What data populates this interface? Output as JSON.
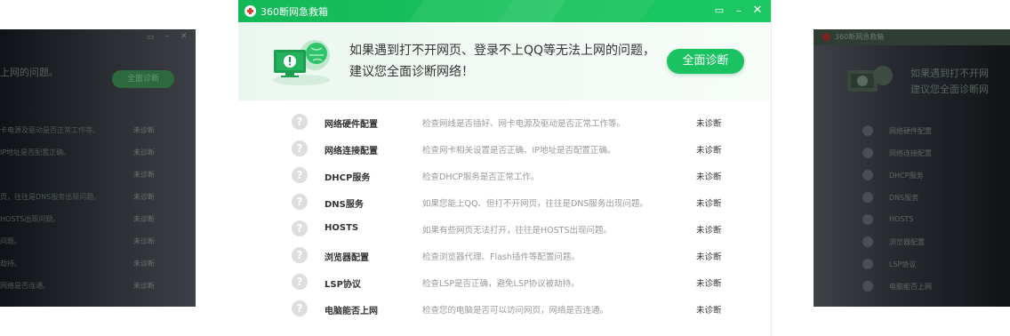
{
  "app": {
    "title": "360断网急救箱"
  },
  "hero": {
    "line1": "如果遇到打不开网页、登录不上QQ等无法上网的问题，",
    "line2": "建议您全面诊断网络！",
    "button": "全面诊断"
  },
  "rows": [
    {
      "name": "网络硬件配置",
      "desc": "检查网线是否插好、网卡电源及驱动是否正常工作等。",
      "status": "未诊断"
    },
    {
      "name": "网络连接配置",
      "desc": "检查网卡相关设置是否正确、IP地址是否配置正确。",
      "status": "未诊断"
    },
    {
      "name": "DHCP服务",
      "desc": "检查DHCP服务是否正常工作。",
      "status": "未诊断"
    },
    {
      "name": "DNS服务",
      "desc": "如果您能上QQ、但打不开网页，往往是DNS服务出现问题。",
      "status": "未诊断"
    },
    {
      "name": "HOSTS",
      "desc": "如果有些网页无法打开，往往是HOSTS出现问题。",
      "status": "未诊断"
    },
    {
      "name": "浏览器配置",
      "desc": "检查浏览器代理、Flash插件等配置问题。",
      "status": "未诊断"
    },
    {
      "name": "LSP协议",
      "desc": "检查LSP是否正确，避免LSP协议被劫持。",
      "status": "未诊断"
    },
    {
      "name": "电脑能否上网",
      "desc": "检查您的电脑是否可以访问网页，网络是否连通。",
      "status": "未诊断"
    }
  ],
  "ghost_left": {
    "hero_fragment": "上网的问题。",
    "button": "全面诊断",
    "row_fragments": [
      "卡电源及驱动是否正常工作等。",
      "IP地址是否配置正确。",
      "",
      "页，往往是DNS服务出现问题。",
      "HOSTS出现问题。",
      "问题。",
      "劫持。",
      "网络是否连通。"
    ],
    "status": "未诊断"
  },
  "ghost_right": {
    "title": "360断网急救箱",
    "hero_line1": "如果遇到打不开网",
    "hero_line2": "建议您全面诊断网",
    "row_names": [
      "网络硬件配置",
      "网络连接配置",
      "DHCP服务",
      "DNS服务",
      "HOSTS",
      "浏览器配置",
      "LSP协议",
      "电脑能否上网"
    ]
  },
  "colors": {
    "accent": "#1bc262",
    "title_bar": "#19c35e"
  }
}
